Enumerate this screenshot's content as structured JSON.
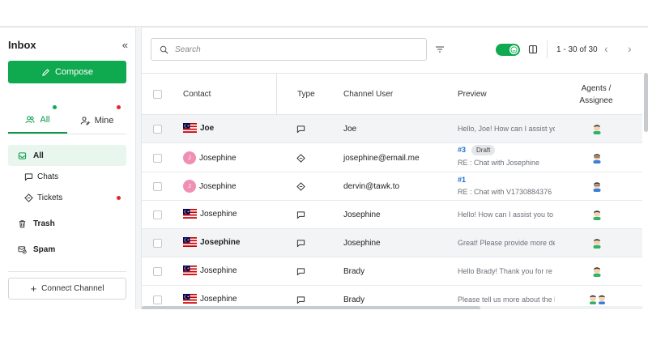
{
  "sidebar": {
    "title": "Inbox",
    "collapse_icon": "double-chevron-left-icon",
    "compose_label": "Compose",
    "filter_tabs": [
      {
        "label": "All",
        "icon": "users-icon",
        "active": true,
        "indicator": "#0faa4f"
      },
      {
        "label": "Mine",
        "icon": "user-edit-icon",
        "active": false,
        "indicator": "#e5262d"
      }
    ],
    "nav": [
      {
        "label": "All",
        "icon": "inbox-icon",
        "active": true
      },
      {
        "label": "Chats",
        "icon": "chat-bubble-icon",
        "sub": true
      },
      {
        "label": "Tickets",
        "icon": "ticket-icon",
        "sub": true,
        "unread": true
      },
      {
        "label": "Trash",
        "icon": "trash-icon"
      },
      {
        "label": "Spam",
        "icon": "spam-icon"
      }
    ],
    "connect_label": "Connect Channel"
  },
  "toolbar": {
    "search_placeholder": "Search",
    "pagination": "1 - 30 of 30",
    "toggle_on": true
  },
  "table": {
    "headers": {
      "contact": "Contact",
      "type": "Type",
      "channel_user": "Channel User",
      "preview": "Preview",
      "agents_line1": "Agents /",
      "agents_line2": "Assignee"
    },
    "rows": [
      {
        "contact": "Joe",
        "avatar": "flag-malaysia",
        "bold": true,
        "type": "chat",
        "channel_user": "Joe",
        "preview": "Hello, Joe! How can I assist yo",
        "agents": 1,
        "highlight": true
      },
      {
        "contact": "Josephine",
        "avatar": "J",
        "type": "ticket",
        "channel_user": "josephine@email.me",
        "ticket_id": "#3",
        "badge": "Draft",
        "preview": "RE : Chat with Josephine",
        "agents": 1,
        "agent_style": "glasses"
      },
      {
        "contact": "Josephine",
        "avatar": "J",
        "type": "ticket",
        "channel_user": "dervin@tawk.to",
        "ticket_id": "#1",
        "preview": "RE : Chat with V1730884376",
        "agents": 1,
        "agent_style": "glasses"
      },
      {
        "contact": "Josephine",
        "avatar": "flag-malaysia",
        "type": "chat",
        "channel_user": "Josephine",
        "preview": "Hello! How can I assist you to",
        "agents": 1
      },
      {
        "contact": "Josephine",
        "avatar": "flag-malaysia",
        "bold": true,
        "type": "chat",
        "channel_user": "Josephine",
        "preview": "Great! Please provide more de",
        "agents": 1,
        "highlight": true
      },
      {
        "contact": "Josephine",
        "avatar": "flag-malaysia",
        "type": "chat",
        "channel_user": "Brady",
        "preview": "Hello Brady! Thank you for re",
        "agents": 1
      },
      {
        "contact": "Josephine",
        "avatar": "flag-malaysia",
        "type": "chat",
        "channel_user": "Brady",
        "preview": "Please tell us more about the l",
        "agents": 2
      }
    ]
  },
  "colors": {
    "brand": "#0faa4f",
    "unread": "#e5262d",
    "ticket_id": "#1f6fd1"
  }
}
